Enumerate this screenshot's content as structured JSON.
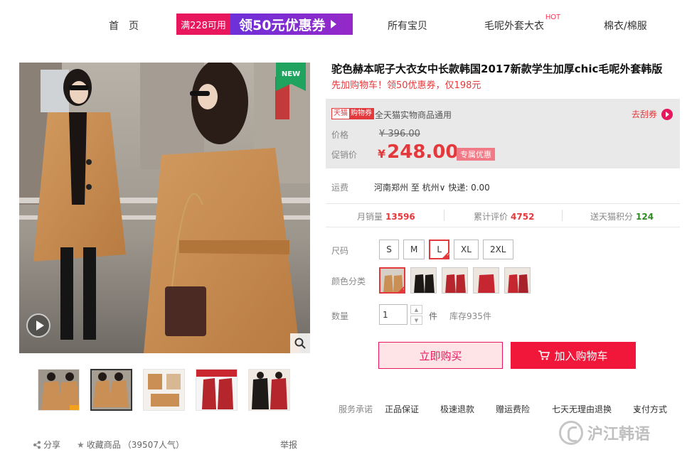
{
  "nav": {
    "home": "首页",
    "coupon_left": "满228可用",
    "coupon_right": "领50元优惠券",
    "all_items": "所有宝贝",
    "wool_coat": "毛呢外套大衣",
    "hot": "HOT",
    "cotton": "棉衣/棉服"
  },
  "main_image": {
    "badge": "NEW"
  },
  "product": {
    "title": "驼色赫本呢子大衣女中长款韩国2017新款学生加厚chic毛呢外套韩版",
    "subtitle": "先加购物车！领50优惠券，仅198元"
  },
  "price_box": {
    "tmall_a": "天猫",
    "tmall_b": "购物券",
    "tmall_text": "全天猫实物商品通用",
    "grab_coupon": "去刮券",
    "price_label": "价格",
    "orig_price": "¥ 396.00",
    "promo_label": "促销价",
    "promo_yen": "¥",
    "promo_price": "248.00",
    "promo_tag": "专属优惠"
  },
  "shipping": {
    "label": "运费",
    "value": "河南郑州 至 杭州∨ 快递: 0.00"
  },
  "stats": {
    "monthly_label": "月销量",
    "monthly_value": "13596",
    "reviews_label": "累计评价",
    "reviews_value": "4752",
    "points_label": "送天猫积分",
    "points_value": "124"
  },
  "size": {
    "label": "尺码",
    "options": [
      "S",
      "M",
      "L",
      "XL",
      "2XL"
    ],
    "selected": "L"
  },
  "color": {
    "label": "颜色分类"
  },
  "quantity": {
    "label": "数量",
    "value": "1",
    "up": "▲",
    "down": "▼",
    "unit": "件",
    "stock": "库存935件"
  },
  "buttons": {
    "buy_now": "立即购买",
    "add_cart": "加入购物车"
  },
  "promises": {
    "label": "服务承诺",
    "items": [
      "正品保证",
      "极速退款",
      "赠运费险",
      "七天无理由退换"
    ],
    "payment": "支付方式"
  },
  "share": {
    "share": "分享",
    "favorite": "收藏商品",
    "popularity": "（39507人气）",
    "report": "举报"
  },
  "watermark": {
    "text": "沪江韩语"
  },
  "colors": {
    "accent": "#e4393c",
    "coupon_pink": "#e8175d",
    "coupon_purple": "#7c2ad2",
    "green": "#2e8b23"
  }
}
